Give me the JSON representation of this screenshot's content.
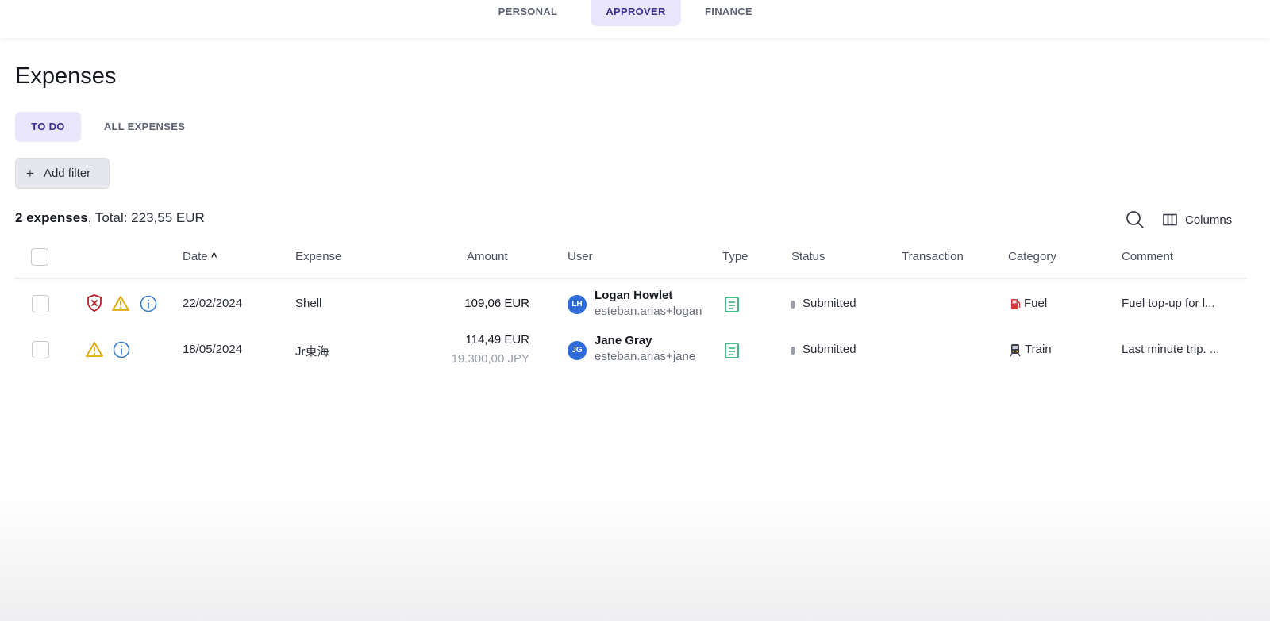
{
  "roles": [
    {
      "label": "PERSONAL",
      "active": false
    },
    {
      "label": "APPROVER",
      "active": true
    },
    {
      "label": "FINANCE",
      "active": false
    }
  ],
  "page": {
    "title": "Expenses"
  },
  "tabs": [
    {
      "label": "TO DO",
      "active": true
    },
    {
      "label": "ALL EXPENSES",
      "active": false
    }
  ],
  "filter": {
    "add_label": "Add filter"
  },
  "summary": {
    "count_text": "2 expenses",
    "total_text": ", Total: 223,55 EUR"
  },
  "toolbar": {
    "columns_label": "Columns"
  },
  "columns": [
    "Date",
    "Expense",
    "Amount",
    "User",
    "Type",
    "Status",
    "Transaction",
    "Category",
    "Comment"
  ],
  "sort_indicator": "^",
  "rows": [
    {
      "date": "22/02/2024",
      "expense": "Shell",
      "amount": "109,06 EUR",
      "amount_original": "",
      "user_initials": "LH",
      "user_name": "Logan Howlet",
      "user_email": "esteban.arias+logan",
      "status": "Submitted",
      "transaction": "",
      "category": "Fuel",
      "category_icon": "fuel-pump-icon",
      "comment": "Fuel top-up for l...",
      "flags": [
        "shield-alert-icon",
        "warning-icon",
        "info-icon"
      ]
    },
    {
      "date": "18/05/2024",
      "expense": "Jr東海",
      "amount": "114,49 EUR",
      "amount_original": "19.300,00 JPY",
      "user_initials": "JG",
      "user_name": "Jane Gray",
      "user_email": "esteban.arias+jane",
      "status": "Submitted",
      "transaction": "",
      "category": "Train",
      "category_icon": "train-icon",
      "comment": "Last minute trip. ...",
      "flags": [
        "warning-icon",
        "info-icon"
      ]
    }
  ],
  "colors": {
    "accent_bg": "#e9e6fb",
    "accent_text": "#3a2f8c",
    "avatar": "#2e6ad8",
    "warning": "#e0a800",
    "danger": "#b3202a",
    "info": "#3b7fd1",
    "receipt": "#2fb37a"
  }
}
